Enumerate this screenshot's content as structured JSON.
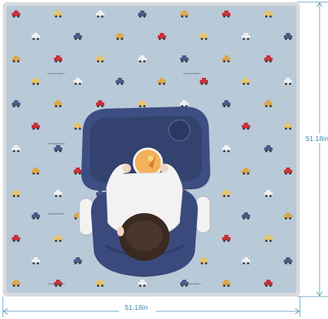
{
  "dimensions": {
    "height_label": "51.18in",
    "width_label": "51.18in"
  },
  "pattern_text": "Transportation",
  "colors": {
    "mat": "#b8c9d8",
    "border": "#d9dbdd",
    "measure": "#3a8fb2",
    "tray": "#3d4e82",
    "seat": "#3a4a7c"
  }
}
